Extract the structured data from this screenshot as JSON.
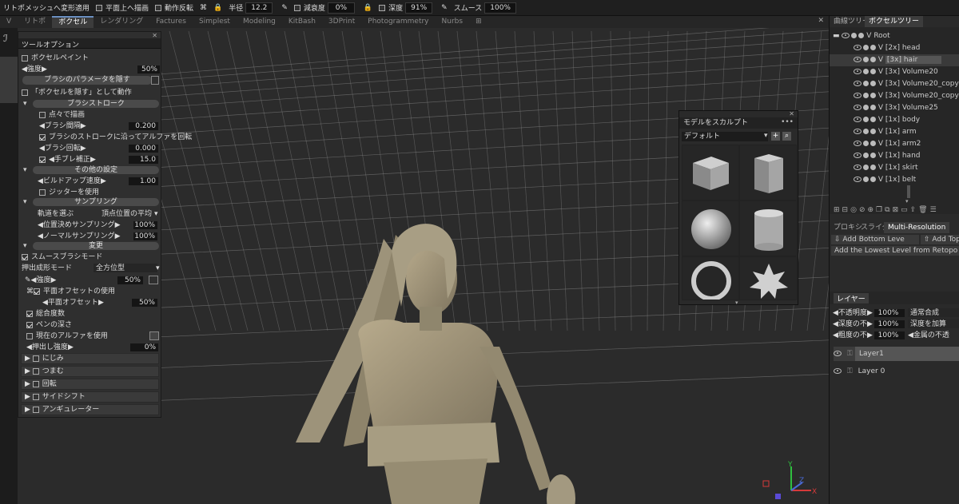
{
  "topbar": {
    "mesh_transform": "リトポメッシュへ変形適用",
    "plane_draw": "平面上へ描画",
    "motion_invert": "動作反転",
    "radius_label": "半径",
    "radius_value": "12.2",
    "decay_label": "減衰度",
    "decay_value": "0%",
    "depth_label": "深度",
    "depth_value": "91%",
    "smooth_label": "スムース",
    "smooth_value": "100%"
  },
  "tabs": [
    "V",
    "リトポ",
    "ボクセル",
    "レンダリング",
    "Factures",
    "Simplest",
    "Modeling",
    "KitBash",
    "3DPrint",
    "Photogrammetry",
    "Nurbs"
  ],
  "tool_options": {
    "title": "ツールオプション",
    "voxel_paint": "ボクセルペイント",
    "strength_label": "強度",
    "strength_value": "50%",
    "hide_brush_params": "ブラシのパラメータを隠す",
    "hide_voxel": "「ボクセルを隠す」として動作",
    "brush_stroke": "ブラシストローク",
    "dot_draw": "点々で描画",
    "brush_spacing_label": "ブラシ間隔",
    "brush_spacing_value": "0.200",
    "rotate_alpha": "ブラシのストロークに沿ってアルファを回転",
    "brush_rotation_label": "ブラシ回転",
    "brush_rotation_value": "0.000",
    "jitter_label": "手ブレ補正",
    "jitter_value": "15.0",
    "other_settings": "その他の設定",
    "buildup_label": "ビルドアップ速度",
    "buildup_value": "1.00",
    "use_jitter": "ジッターを使用",
    "sampling": "サンプリング",
    "orbit_label": "軌道を選ぶ",
    "orbit_value": "頂点位置の平均",
    "pos_sampling_label": "位置決めサンプリング",
    "pos_sampling_value": "100%",
    "normal_sampling_label": "ノーマルサンプリング",
    "normal_sampling_value": "100%",
    "deform": "変更",
    "smooth_brush": "スムースブラシモード",
    "extrude_mode_label": "押出成形モード",
    "extrude_mode_value": "全方位型",
    "strength2_label": "強度",
    "strength2_value": "50%",
    "use_plane_offset": "平面オフセットの使用",
    "plane_offset_label": "平面オフセット",
    "plane_offset_value": "50%",
    "total_depth": "総合度数",
    "pen_depth": "ペンの深さ",
    "use_current_alpha": "現在のアルファを使用",
    "extrude_strength_label": "押出し強度",
    "extrude_strength_value": "0%",
    "collapsed": [
      "にじみ",
      "つまむ",
      "回転",
      "サイドシフト",
      "アンギュレーター"
    ]
  },
  "sculpt_panel": {
    "title": "モデルをスカルプト",
    "preset": "デフォルト",
    "shapes": [
      "cube",
      "cuboid",
      "sphere",
      "cylinder",
      "torus",
      "spiky-ball"
    ]
  },
  "right_panel": {
    "tab_curves": "曲線ツリー",
    "tab_voxel": "ボクセルツリー",
    "tree": [
      {
        "flag": "V",
        "label": "Root",
        "level": 0
      },
      {
        "flag": "V",
        "label": "[2x]  head",
        "level": 1
      },
      {
        "flag": "V",
        "label": "[3x]  hair",
        "level": 1
      },
      {
        "flag": "V",
        "label": "[3x]  Volume20",
        "level": 1
      },
      {
        "flag": "V",
        "label": "[3x]  Volume20_copy0(",
        "level": 1
      },
      {
        "flag": "V",
        "label": "[3x]  Volume20_copy0(",
        "level": 1
      },
      {
        "flag": "V",
        "label": "[3x]  Volume25",
        "level": 1
      },
      {
        "flag": "V",
        "label": "[1x]  body",
        "level": 1
      },
      {
        "flag": "V",
        "label": "[1x]  arm",
        "level": 1
      },
      {
        "flag": "V",
        "label": "[1x]  arm2",
        "level": 1
      },
      {
        "flag": "V",
        "label": "[1x]  hand",
        "level": 1
      },
      {
        "flag": "V",
        "label": "[1x]  skirt",
        "level": 1
      },
      {
        "flag": "V",
        "label": "[1x]  belt",
        "level": 1
      }
    ],
    "tab_proxy": "プロキシ",
    "tab_slider": "スライダ",
    "tab_multires": "Multi-Resolution",
    "add_bottom": "Add Bottom Leve",
    "add_top": "Add Top L",
    "add_lowest": "Add the Lowest Level from Retopo",
    "layers_title": "レイヤー",
    "opacity_label": "不透明度",
    "opacity_value": "100%",
    "blend_value": "通常合成",
    "depth_label": "深度の不",
    "depth_value": "100%",
    "depth_blend": "深度を加算",
    "rough_label": "粗度の不",
    "rough_value": "100%",
    "metal_label": "金属の不透",
    "layers": [
      "Layer1",
      "Layer 0"
    ]
  },
  "gizmo": {
    "y": "Y",
    "x": "X",
    "z": "Z"
  }
}
